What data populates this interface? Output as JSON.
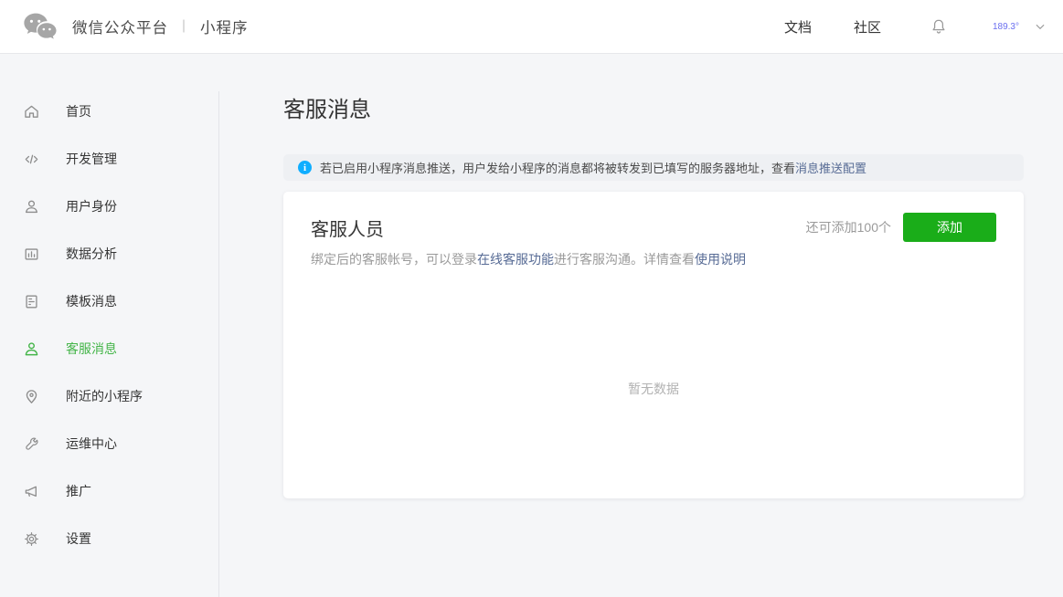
{
  "header": {
    "title_main": "微信公众平台",
    "title_sep": "｜",
    "title_sub": "小程序",
    "nav_doc": "文档",
    "nav_community": "社区",
    "account": "189.3°"
  },
  "sidebar": {
    "items": [
      {
        "label": "首页",
        "icon": "home-icon",
        "active": false
      },
      {
        "label": "开发管理",
        "icon": "code-icon",
        "active": false
      },
      {
        "label": "用户身份",
        "icon": "user-icon",
        "active": false
      },
      {
        "label": "数据分析",
        "icon": "bar-chart-icon",
        "active": false
      },
      {
        "label": "模板消息",
        "icon": "template-document-icon",
        "active": false
      },
      {
        "label": "客服消息",
        "icon": "customer-service-icon",
        "active": true
      },
      {
        "label": "附近的小程序",
        "icon": "location-pin-icon",
        "active": false
      },
      {
        "label": "运维中心",
        "icon": "wrench-icon",
        "active": false
      },
      {
        "label": "推广",
        "icon": "megaphone-icon",
        "active": false
      },
      {
        "label": "设置",
        "icon": "gear-icon",
        "active": false
      }
    ]
  },
  "main": {
    "page_title": "客服消息",
    "banner": {
      "text": "若已启用小程序消息推送，用户发给小程序的消息都将被转发到已填写的服务器地址，查看",
      "link": "消息推送配置"
    },
    "card": {
      "title": "客服人员",
      "quota": "还可添加100个",
      "add_button": "添加",
      "desc_part1": "绑定后的客服帐号，可以登录",
      "desc_link1": "在线客服功能",
      "desc_part2": "进行客服沟通。详情查看",
      "desc_link2": "使用说明",
      "empty": "暂无数据"
    }
  },
  "colors": {
    "brand_green": "#1aad19",
    "sidebar_active_green": "#44b549",
    "link_blue": "#576b95",
    "info_blue": "#10aeff",
    "account_blue": "#6a6ff0"
  }
}
